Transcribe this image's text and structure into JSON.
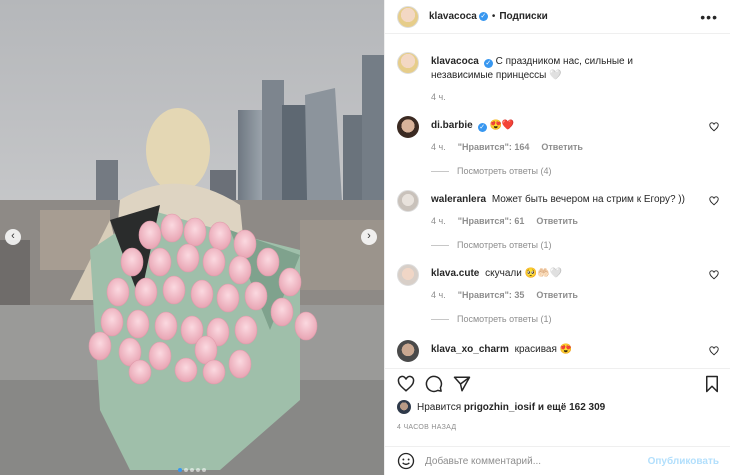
{
  "header": {
    "username": "klavacoca",
    "verified_icon": "verified-badge-icon",
    "separator": "•",
    "follow_label": "Подписки",
    "more_icon": "more-options-icon"
  },
  "caption": {
    "username": "klavacoca",
    "text": "С праздником нас, сильные и независимые принцессы 🤍",
    "time": "4 ч."
  },
  "comments": [
    {
      "username": "di.barbie",
      "verified": true,
      "text": "😍❤️",
      "time": "4 ч.",
      "likes": "\"Нравится\": 164",
      "reply": "Ответить",
      "view_replies": "Посмотреть ответы (4)"
    },
    {
      "username": "waleranlera",
      "verified": false,
      "text": "Может быть вечером на стрим к Егору? ))",
      "time": "4 ч.",
      "likes": "\"Нравится\": 61",
      "reply": "Ответить",
      "view_replies": "Посмотреть ответы (1)"
    },
    {
      "username": "klava.cute",
      "verified": false,
      "text": "скучали 🥺🤲🏻🤍",
      "time": "4 ч.",
      "likes": "\"Нравится\": 35",
      "reply": "Ответить",
      "view_replies": "Посмотреть ответы (1)"
    },
    {
      "username": "klava_xo_charm",
      "verified": false,
      "text": "красивая 😍"
    }
  ],
  "likes_line": {
    "prefix": "Нравится",
    "username": "prigozhin_iosif",
    "suffix": "и ещё 162 309"
  },
  "timestamp": "4 ЧАСОВ НАЗАД",
  "add_comment": {
    "placeholder": "Добавьте комментарий...",
    "publish_label": "Опубликовать"
  },
  "colors": {
    "accent": "#3897f0",
    "publish_disabled": "#b2dffc",
    "like_red": "#ed4956",
    "secondary_text": "#8e8e8e"
  },
  "carousel": {
    "slides": 5,
    "active": 1
  }
}
